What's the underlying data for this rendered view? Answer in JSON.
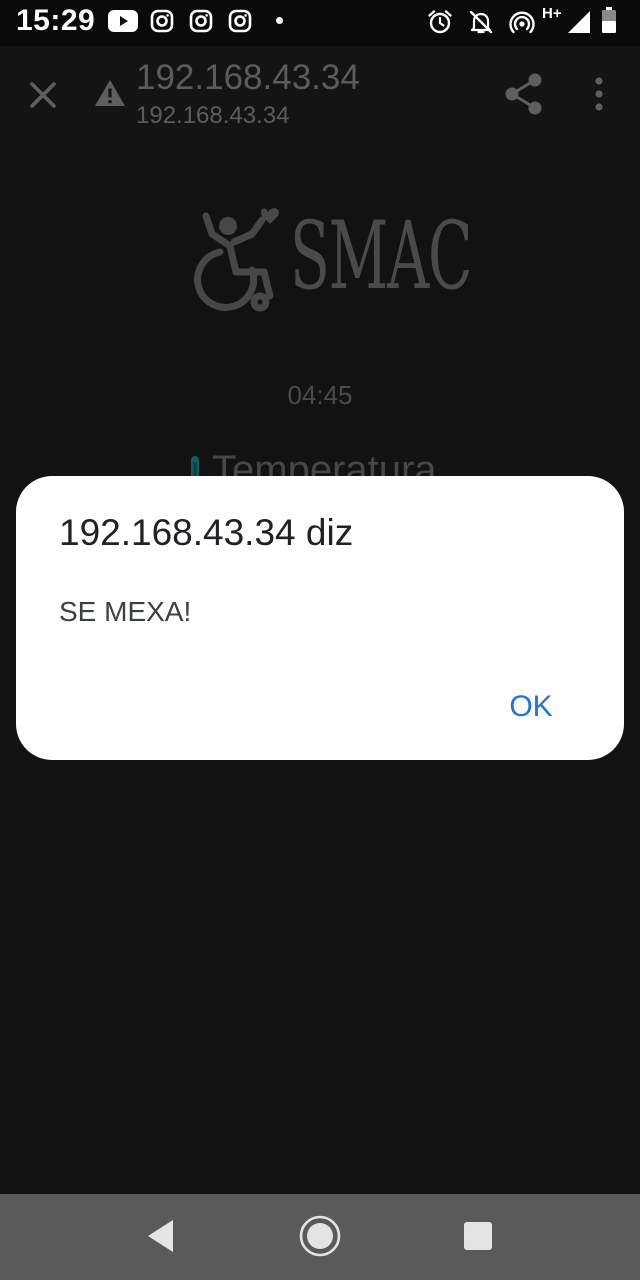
{
  "status_bar": {
    "time": "15:29",
    "network": "H+",
    "icons": [
      "youtube-icon",
      "instagram-icon",
      "instagram-icon",
      "instagram-icon",
      "notification-dot",
      "alarm-icon",
      "notifications-off-icon",
      "hotspot-icon",
      "signal-icon",
      "battery-icon"
    ]
  },
  "toolbar": {
    "title": "192.168.43.34",
    "subtitle": "192.168.43.34",
    "icons": [
      "close-icon",
      "warning-icon",
      "share-icon",
      "more-vert-icon"
    ]
  },
  "page": {
    "logo_text": "SMAC",
    "clock": "04:45",
    "temperature_label": "Temperatura",
    "colors": {
      "thermometer": "#0c5f5c"
    }
  },
  "dialog": {
    "title": "192.168.43.34 diz",
    "message": "SE MEXA!",
    "ok_label": "OK",
    "colors": {
      "accent": "#1a73e8"
    }
  },
  "nav_bar": {
    "icons": [
      "back-icon",
      "home-icon",
      "recents-icon"
    ]
  }
}
